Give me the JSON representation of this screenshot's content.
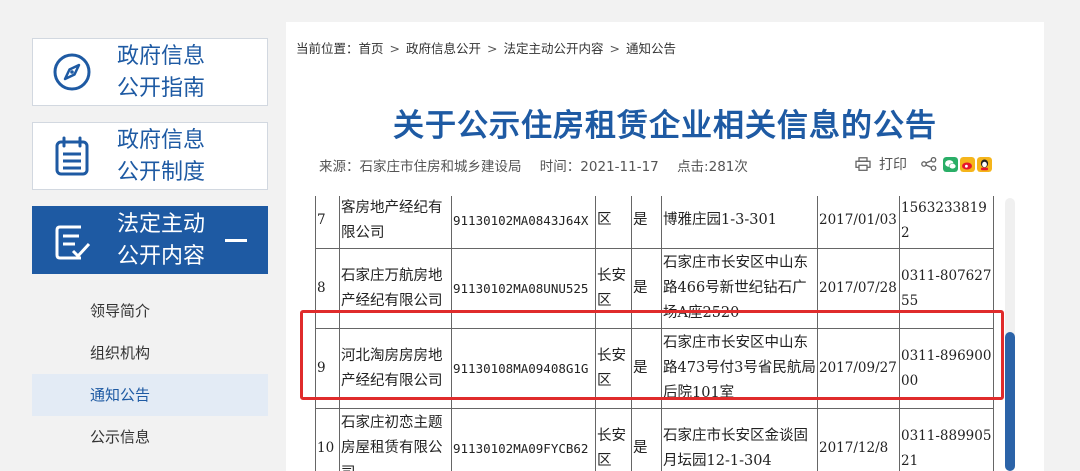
{
  "sidebar": {
    "boxes": [
      {
        "label": "政府信息\n公开指南",
        "icon": "compass-icon"
      },
      {
        "label": "政府信息\n公开制度",
        "icon": "clipboard-icon"
      },
      {
        "label": "法定主动\n公开内容",
        "icon": "document-check-icon",
        "toggle": "collapse-minus-icon"
      }
    ],
    "sub_items": [
      "领导简介",
      "组织机构",
      "通知公告",
      "公示信息"
    ],
    "active_sub": "通知公告"
  },
  "breadcrumb": {
    "prefix": "当前位置：",
    "items": [
      "首页",
      "政府信息公开",
      "法定主动公开内容",
      "通知公告"
    ],
    "separator": ">"
  },
  "article": {
    "title": "关于公示住房租赁企业相关信息的公告",
    "source": "来源：石家庄市住房和城乡建设局",
    "time": "时间：2021-11-17",
    "clicks": "点击:281次",
    "print_label": "打印"
  },
  "colors": {
    "brand_blue": "#1e5aa3",
    "highlight_red": "#e02b2b",
    "wechat_green": "#2aae67",
    "weibo_red": "#e6162d",
    "qzone_yellow": "#f5b51b"
  },
  "table": {
    "rows": [
      {
        "no": "7",
        "name": "客房地产经纪有限公司",
        "code": "91130102MA0843J64X",
        "district": "区",
        "flag": "是",
        "address": "博雅庄园1-3-301",
        "date": "2017/01/03",
        "phone": "15632338192"
      },
      {
        "no": "8",
        "name": "石家庄万航房地产经纪有限公司",
        "code": "91130102MA08UNU525",
        "district": "长安区",
        "flag": "是",
        "address": "石家庄市长安区中山东路466号新世纪钻石广场A座2520",
        "date": "2017/07/28",
        "phone": "0311-80762755"
      },
      {
        "no": "9",
        "name": "河北淘房房房地产经纪有限公司",
        "code": "91130108MA09408G1G",
        "district": "长安区",
        "flag": "是",
        "address": "石家庄市长安区中山东路473号付3号省民航局后院101室",
        "date": "2017/09/27",
        "phone": "0311-89690000"
      },
      {
        "no": "10",
        "name": "石家庄初恋主题房屋租赁有限公司",
        "code": "91130102MA09FYCB62",
        "district": "长安区",
        "flag": "是",
        "address": "石家庄市长安区金谈固月坛园12-1-304",
        "date": "2017/12/8",
        "phone": "0311-88990521"
      }
    ]
  }
}
